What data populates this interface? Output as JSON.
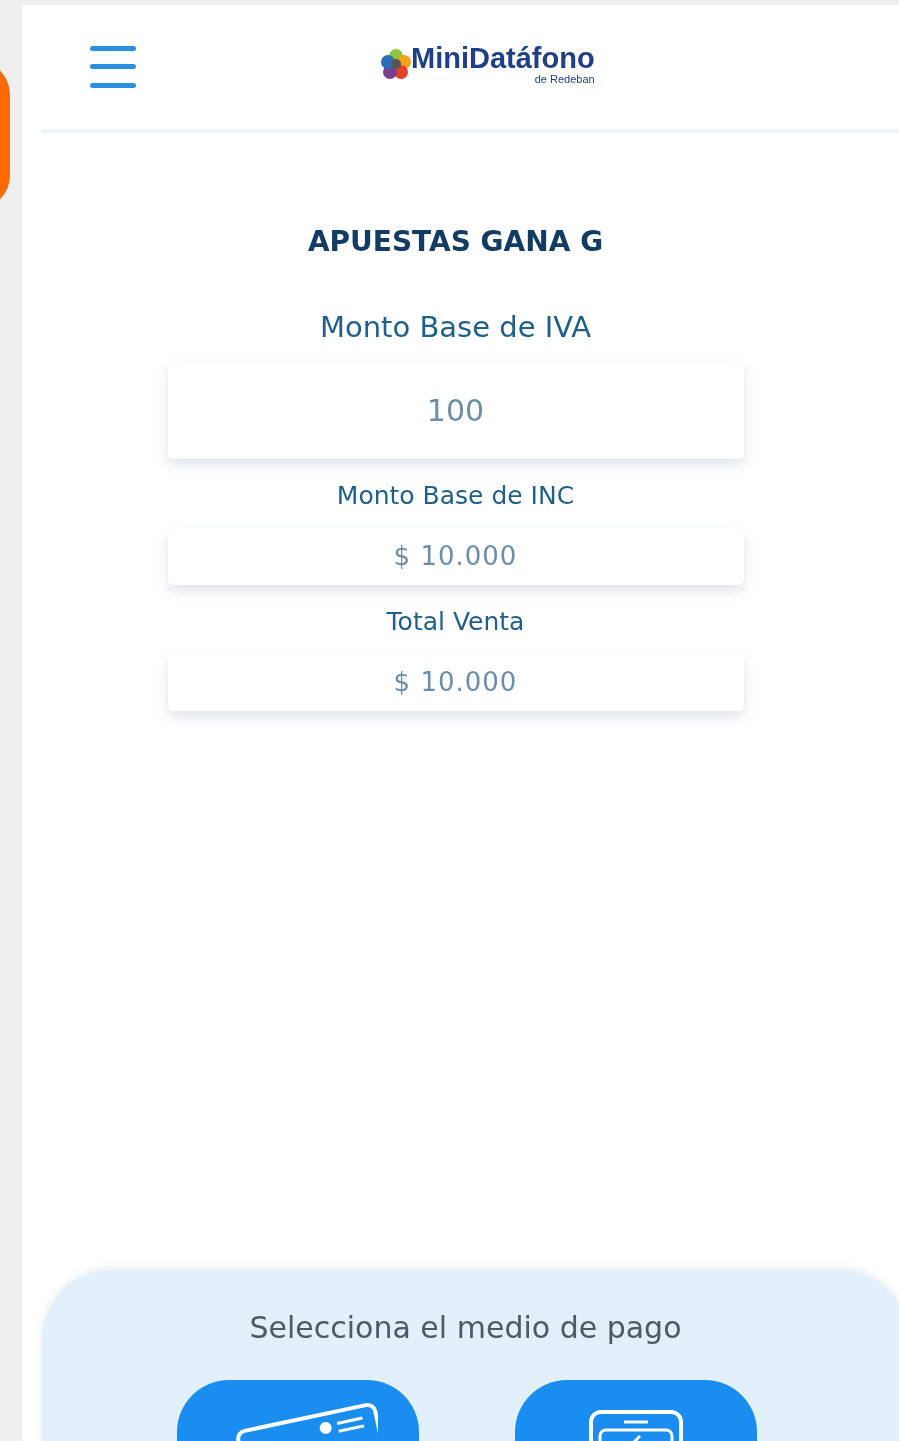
{
  "header": {
    "logo_title": "MiniDatáfono",
    "logo_subtitle": "de Redeban"
  },
  "merchant": "APUESTAS GANA G",
  "fields": [
    {
      "kind": "large",
      "label": "Monto Base de IVA",
      "value": "100"
    },
    {
      "kind": "small",
      "label": "Monto Base de INC",
      "value": "$ 10.000"
    },
    {
      "kind": "small",
      "label": "Total Venta",
      "value": "$ 10.000"
    }
  ],
  "payment": {
    "title": "Selecciona el medio de pago",
    "buttons": [
      {
        "kind": "card"
      },
      {
        "kind": "phone"
      }
    ]
  }
}
